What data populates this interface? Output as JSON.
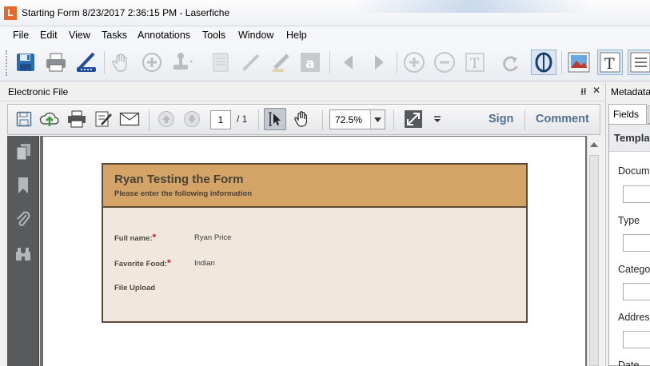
{
  "window": {
    "app_icon_letter": "L",
    "title": "Starting Form 8/23/2017 2:36:15 PM - Laserfiche"
  },
  "menu": [
    "File",
    "Edit",
    "View",
    "Tasks",
    "Annotations",
    "Tools",
    "Window",
    "Help"
  ],
  "main_toolbar": {
    "icons": [
      "save-icon",
      "print-icon",
      "scan-icon",
      "hand-icon",
      "zoom-in-icon",
      "stamp-icon",
      "page-icon",
      "pen-icon",
      "highlighter-icon",
      "text-box-icon",
      "previous-icon",
      "next-icon",
      "plus-icon",
      "minus-icon",
      "text-icon",
      "redo-icon",
      "ocr-icon",
      "image-view-icon",
      "text-view-icon",
      "list-view-icon"
    ]
  },
  "electronic_file": {
    "panel_title": "Electronic File",
    "pin_glyph": "⭿",
    "close_glyph": "✕",
    "page_current": "1",
    "page_total": "/ 1",
    "zoom": "72.5%",
    "sign_label": "Sign",
    "comment_label": "Comment"
  },
  "form": {
    "title": "Ryan Testing the Form",
    "subtitle": "Please enter the following information",
    "required_marker": "*",
    "fields": [
      {
        "label": "Full name:",
        "required": true,
        "value": "Ryan Price"
      },
      {
        "label": "Favorite Food:",
        "required": true,
        "value": "Indian"
      },
      {
        "label": "File Upload",
        "required": false,
        "value": ""
      }
    ]
  },
  "metadata": {
    "panel_title": "Metadata",
    "tab_fields": "Fields",
    "section_title": "Template",
    "labels": [
      "Document",
      "Type",
      "Category",
      "Address",
      "Date"
    ]
  },
  "colors": {
    "form_header": "#d3a466",
    "form_body": "#f0e7dd",
    "form_border": "#5d4a33",
    "link_blue": "#52708e",
    "required_red": "#c21f1f"
  }
}
